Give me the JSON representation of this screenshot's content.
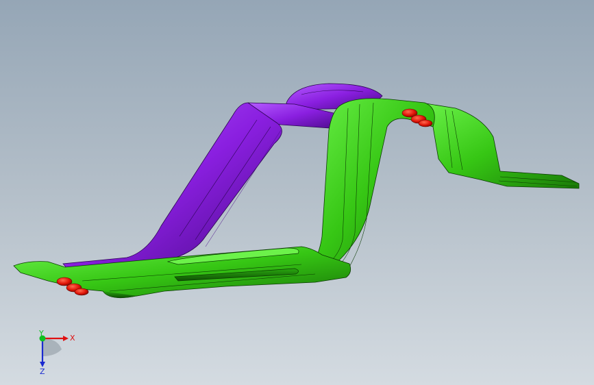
{
  "triad": {
    "x_label": "X",
    "y_label": "Y",
    "z_label": "Z",
    "x_color": "#e01010",
    "y_color": "#10c020",
    "z_color": "#1a2ad0"
  },
  "model": {
    "green_color": "#3dd61a",
    "purple_color": "#8a1fe0",
    "red_color": "#e01408"
  }
}
